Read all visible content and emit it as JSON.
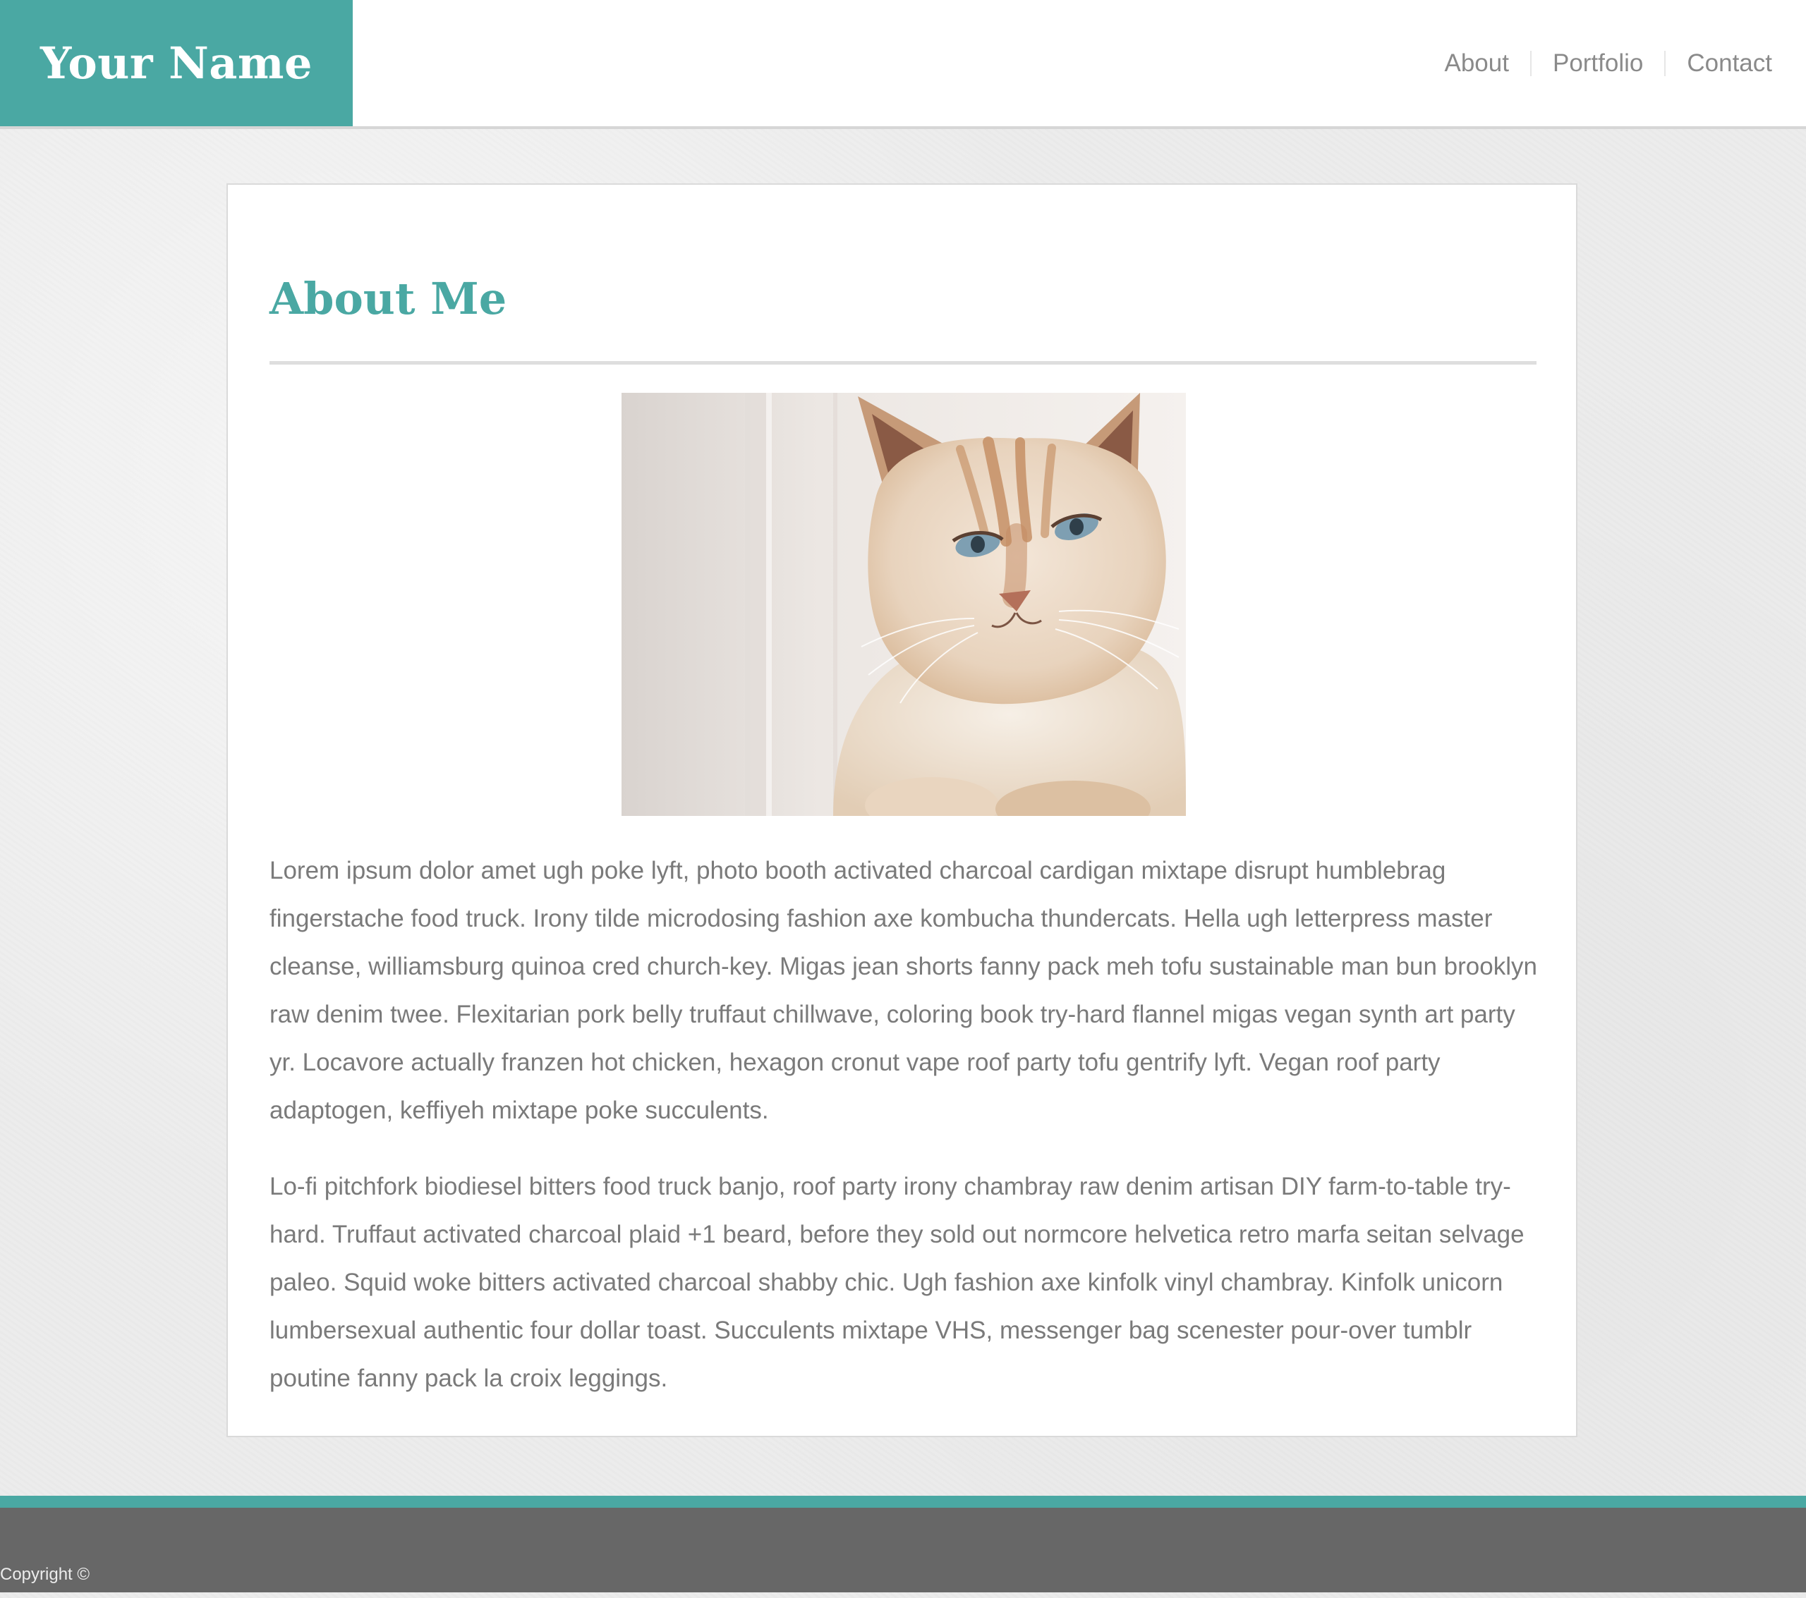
{
  "header": {
    "brand": "Your Name",
    "nav": [
      {
        "label": "About"
      },
      {
        "label": "Portfolio"
      },
      {
        "label": "Contact"
      }
    ]
  },
  "main": {
    "title": "About Me",
    "image": {
      "alt": "Photo of a cream-colored cat with blue eyes"
    },
    "paragraphs": [
      "Lorem ipsum dolor amet ugh poke lyft, photo booth activated charcoal cardigan mixtape disrupt humblebrag fingerstache food truck. Irony tilde microdosing fashion axe kombucha thundercats. Hella ugh letterpress master cleanse, williamsburg quinoa cred church-key. Migas jean shorts fanny pack meh tofu sustainable man bun brooklyn raw denim twee. Flexitarian pork belly truffaut chillwave, coloring book try-hard flannel migas vegan synth art party yr. Locavore actually franzen hot chicken, hexagon cronut vape roof party tofu gentrify lyft. Vegan roof party adaptogen, keffiyeh mixtape poke succulents.",
      "Lo-fi pitchfork biodiesel bitters food truck banjo, roof party irony chambray raw denim artisan DIY farm-to-table try-hard. Truffaut activated charcoal plaid +1 beard, before they sold out normcore helvetica retro marfa seitan selvage paleo. Squid woke bitters activated charcoal shabby chic. Ugh fashion axe kinfolk vinyl chambray. Kinfolk unicorn lumbersexual authentic four dollar toast. Succulents mixtape VHS, messenger bag scenester pour-over tumblr poutine fanny pack la croix leggings."
    ]
  },
  "footer": {
    "copyright": "Copyright ©"
  },
  "colors": {
    "accent": "#4aa8a3",
    "footer": "#676767",
    "body_text": "#7a7a7a",
    "nav_text": "#8a8a8a",
    "background": "#ececec"
  }
}
